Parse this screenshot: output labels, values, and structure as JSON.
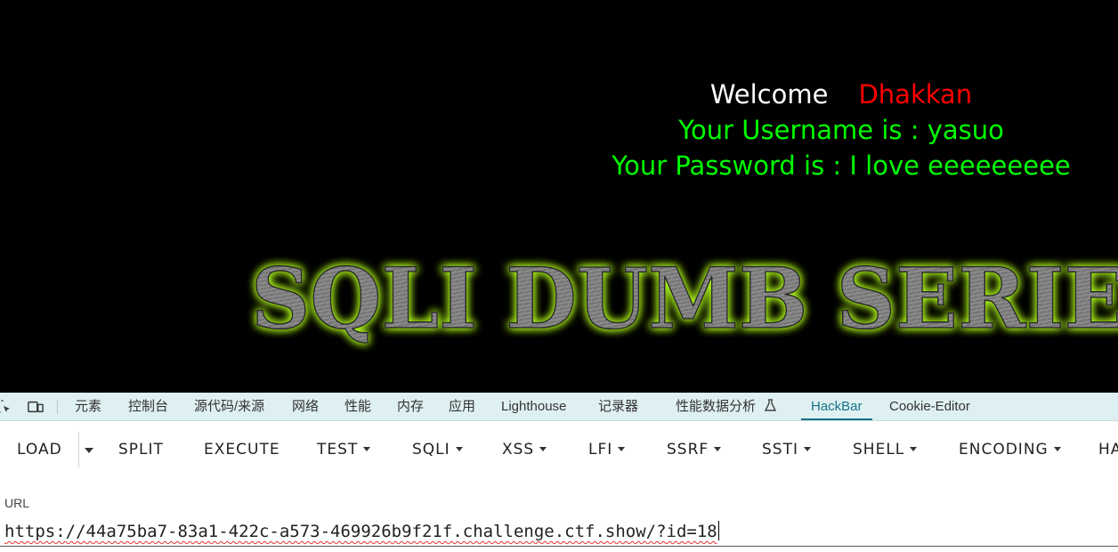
{
  "webpage": {
    "welcome_word": "Welcome",
    "welcome_name": "Dhakkan",
    "username_line": "Your Username is : yasuo",
    "password_line": "Your Password is : I love eeeeeeeee",
    "banner_text": "SQLI DUMB SERIES"
  },
  "devtools": {
    "tabs": [
      {
        "label": "元素"
      },
      {
        "label": "控制台"
      },
      {
        "label": "源代码/来源"
      },
      {
        "label": "网络"
      },
      {
        "label": "性能"
      },
      {
        "label": "内存"
      },
      {
        "label": "应用"
      },
      {
        "label": "Lighthouse"
      },
      {
        "label": "记录器"
      },
      {
        "label": "性能数据分析"
      },
      {
        "label": "HackBar"
      },
      {
        "label": "Cookie-Editor"
      }
    ],
    "active_tab": "HackBar"
  },
  "hackbar": {
    "buttons": [
      {
        "label": "LOAD"
      },
      {
        "label": "SPLIT"
      },
      {
        "label": "EXECUTE"
      },
      {
        "label": "TEST"
      },
      {
        "label": "SQLI"
      },
      {
        "label": "XSS"
      },
      {
        "label": "LFI"
      },
      {
        "label": "SSRF"
      },
      {
        "label": "SSTI"
      },
      {
        "label": "SHELL"
      },
      {
        "label": "ENCODING"
      },
      {
        "label": "HA"
      }
    ],
    "url_label": "URL",
    "url_value": "https://44a75ba7-83a1-422c-a573-469926b9f21f.challenge.ctf.show/?id=18"
  },
  "colors": {
    "page_background": "#000000",
    "welcome_color": "#ffffff",
    "name_color": "#ff0000",
    "result_color": "#00ff00",
    "banner_glow": "#b4ff1e",
    "devtools_bg": "#dff0f2",
    "active_tab_color": "#1a7389"
  }
}
